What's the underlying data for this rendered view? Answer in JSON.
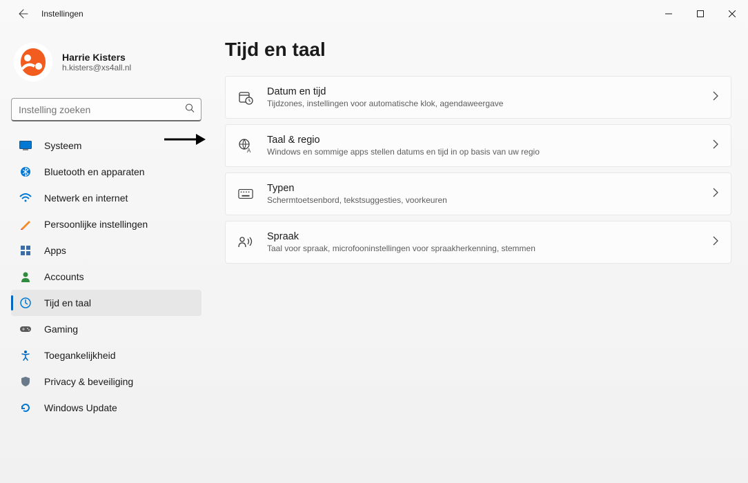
{
  "header": {
    "app_title": "Instellingen"
  },
  "profile": {
    "name": "Harrie Kisters",
    "email": "h.kisters@xs4all.nl"
  },
  "search": {
    "placeholder": "Instelling zoeken"
  },
  "sidebar": {
    "items": [
      {
        "label": "Systeem"
      },
      {
        "label": "Bluetooth en apparaten"
      },
      {
        "label": "Netwerk en internet"
      },
      {
        "label": "Persoonlijke instellingen"
      },
      {
        "label": "Apps"
      },
      {
        "label": "Accounts"
      },
      {
        "label": "Tijd en taal"
      },
      {
        "label": "Gaming"
      },
      {
        "label": "Toegankelijkheid"
      },
      {
        "label": "Privacy & beveiliging"
      },
      {
        "label": "Windows Update"
      }
    ],
    "active_index": 6
  },
  "page": {
    "title": "Tijd en taal",
    "cards": [
      {
        "title": "Datum en tijd",
        "sub": "Tijdzones, instellingen voor automatische klok, agendaweergave"
      },
      {
        "title": "Taal & regio",
        "sub": "Windows en sommige apps stellen datums en tijd in op basis van uw regio"
      },
      {
        "title": "Typen",
        "sub": "Schermtoetsenbord, tekstsuggesties, voorkeuren"
      },
      {
        "title": "Spraak",
        "sub": "Taal voor spraak, microfooninstellingen voor spraakherkenning, stemmen"
      }
    ]
  }
}
